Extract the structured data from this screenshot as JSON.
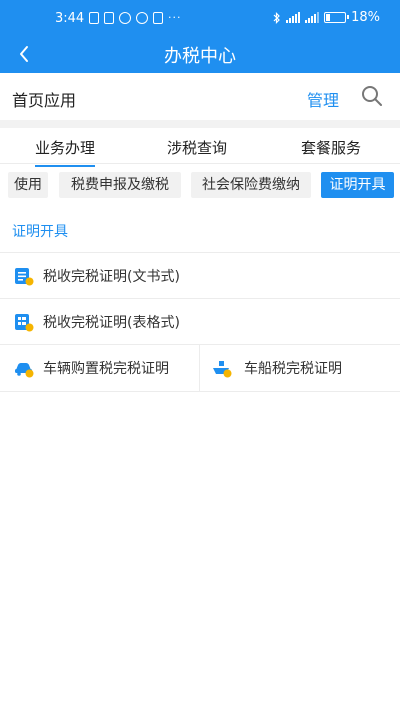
{
  "status": {
    "time": "3:44",
    "battery": "18%"
  },
  "header": {
    "title": "办税中心"
  },
  "section": {
    "title": "首页应用",
    "manage": "管理"
  },
  "tabs": [
    {
      "label": "业务办理",
      "active": true
    },
    {
      "label": "涉税查询",
      "active": false
    },
    {
      "label": "套餐服务",
      "active": false
    }
  ],
  "chips": [
    {
      "label": "使用",
      "active": false
    },
    {
      "label": "税费申报及缴税",
      "active": false
    },
    {
      "label": "社会保险费缴纳",
      "active": false
    },
    {
      "label": "证明开具",
      "active": true
    }
  ],
  "group": {
    "title": "证明开具"
  },
  "items": [
    {
      "label": "税收完税证明(文书式)",
      "icon": "document-certificate-icon"
    },
    {
      "label": "税收完税证明(表格式)",
      "icon": "form-certificate-icon"
    },
    {
      "label": "车辆购置税完税证明",
      "icon": "car-icon"
    },
    {
      "label": "车船税完税证明",
      "icon": "ship-icon"
    }
  ],
  "colors": {
    "accent": "#1f8ff0",
    "badge": "#f5b400"
  }
}
